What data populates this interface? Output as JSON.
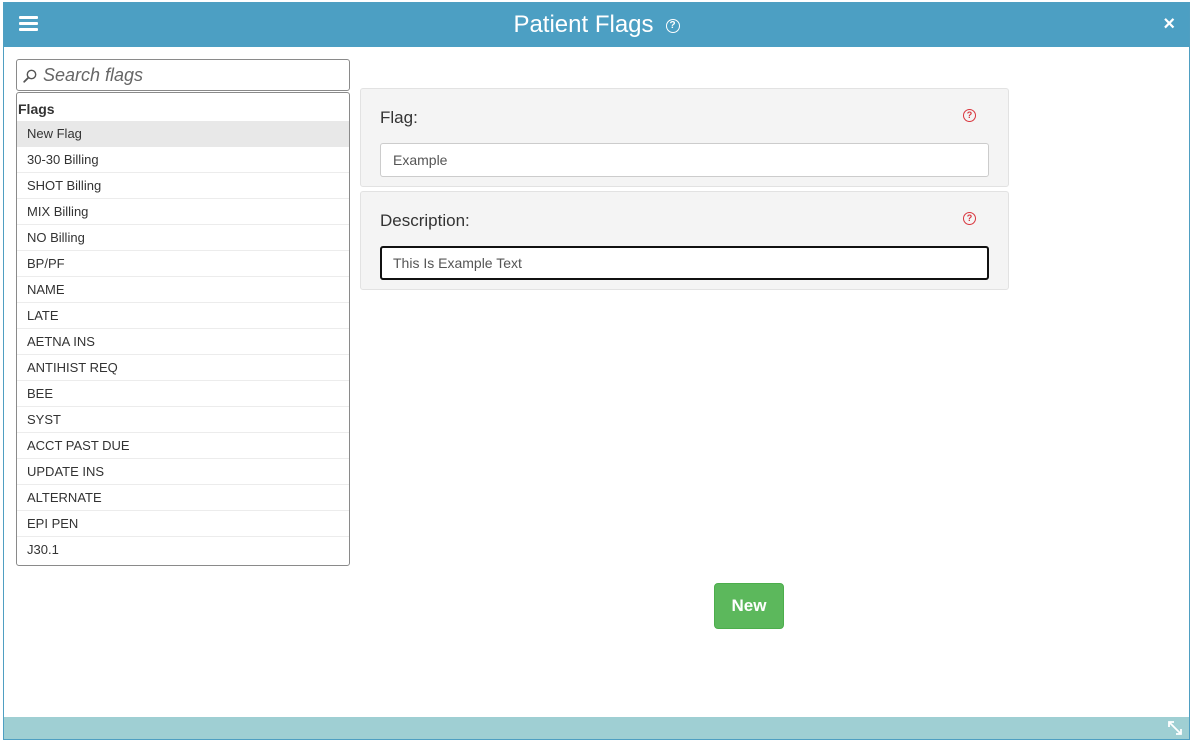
{
  "header": {
    "title": "Patient Flags",
    "help_icon": "?",
    "close_icon": "×",
    "menu_icon": "hamburger-menu-icon"
  },
  "search": {
    "placeholder": "Search flags"
  },
  "flags_list": {
    "header": "Flags",
    "items": [
      "New Flag",
      "30-30 Billing",
      "SHOT Billing",
      "MIX Billing",
      "NO Billing",
      "BP/PF",
      "NAME",
      "LATE",
      "AETNA INS",
      "ANTIHIST REQ",
      "BEE",
      "SYST",
      "ACCT PAST DUE",
      "UPDATE INS",
      "ALTERNATE",
      "EPI PEN",
      "J30.1"
    ],
    "selected_index": 0
  },
  "form": {
    "flag_label": "Flag:",
    "flag_value": "Example",
    "description_label": "Description:",
    "description_value": "This Is Example Text",
    "help_icon": "?"
  },
  "actions": {
    "new_label": "New"
  },
  "colors": {
    "titlebar": "#4c9fc3",
    "footer": "#9fcfd3",
    "new_button": "#5cb85c",
    "help_red": "#d9363e"
  }
}
